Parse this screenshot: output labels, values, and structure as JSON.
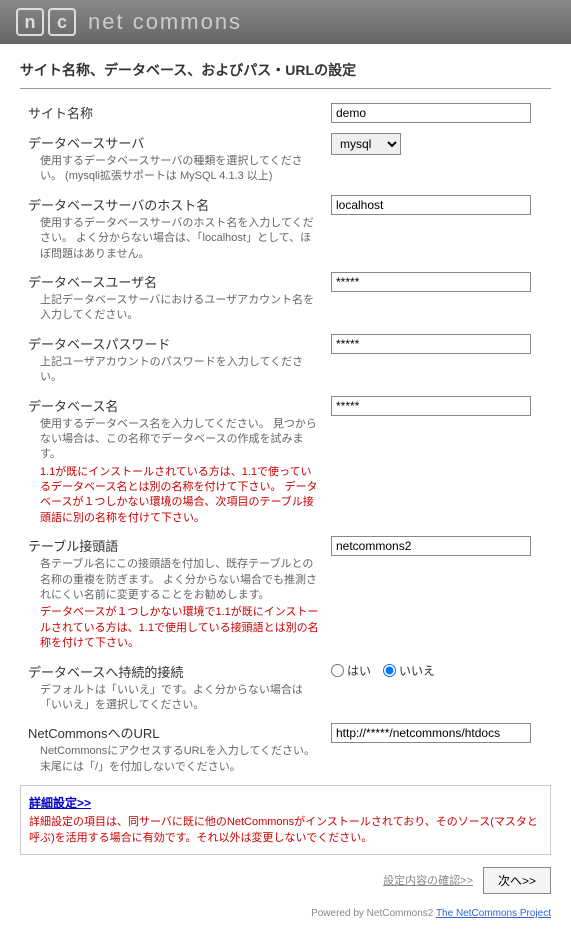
{
  "header": {
    "logo_n": "n",
    "logo_c": "c",
    "brand": "net commons"
  },
  "page_title": "サイト名称、データベース、およびパス・URLの設定",
  "fields": {
    "site_name": {
      "label": "サイト名称",
      "value": "demo"
    },
    "db_server": {
      "label": "データベースサーバ",
      "desc": "使用するデータベースサーバの種類を選択してください。\n(mysqli拡張サポートは MySQL 4.1.3 以上)",
      "value": "mysql"
    },
    "db_host": {
      "label": "データベースサーバのホスト名",
      "desc": "使用するデータベースサーバのホスト名を入力してください。\nよく分からない場合は、「localhost」として、ほぼ問題はありません。",
      "value": "localhost"
    },
    "db_user": {
      "label": "データベースユーザ名",
      "desc": "上記データベースサーバにおけるユーザアカウント名を入力してください。",
      "value": "*****"
    },
    "db_pass": {
      "label": "データベースパスワード",
      "desc": "上記ユーザアカウントのパスワードを入力してください。",
      "value": "*****"
    },
    "db_name": {
      "label": "データベース名",
      "desc1": "使用するデータベース名を入力してください。\n見つからない場合は、この名称でデータベースの作成を試みます。",
      "desc2": "1.1が既にインストールされている方は、1.1で使っているデータベース名とは別の名称を付けて下さい。\nデータベースが１つしかない環境の場合、次項目のテーブル接頭語に別の名称を付けて下さい。",
      "value": "*****"
    },
    "prefix": {
      "label": "テーブル接頭語",
      "desc1": "各テーブル名にこの接頭語を付加し、既存テーブルとの名称の重複を防ぎます。\nよく分からない場合でも推測されにくい名前に変更することをお勧めします。",
      "desc2": "データベースが１つしかない環境で1.1が既にインストールされている方は、1.1で使用している接頭語とは別の名称を付けて下さい。",
      "value": "netcommons2"
    },
    "persistent": {
      "label": "データベースへ持続的接続",
      "desc": "デフォルトは「いいえ」です。よく分からない場合は「いいえ」を選択してください。",
      "yes": "はい",
      "no": "いいえ",
      "value": "no"
    },
    "url": {
      "label": "NetCommonsへのURL",
      "desc": "NetCommonsにアクセスするURLを入力してください。\n末尾には「/」を付加しないでください。",
      "value": "http://*****/netcommons/htdocs"
    }
  },
  "advanced": {
    "link": "詳細設定>>",
    "desc": "詳細設定の項目は、同サーバに既に他のNetCommonsがインストールされており、そのソース(マスタと呼ぶ)を活用する場合に有効です。それ以外は変更しないでください。"
  },
  "footer": {
    "confirm": "設定内容の確認>>",
    "next": "次へ>>"
  },
  "powered": {
    "text": "Powered by NetCommons2 ",
    "link": "The NetCommons Project"
  }
}
